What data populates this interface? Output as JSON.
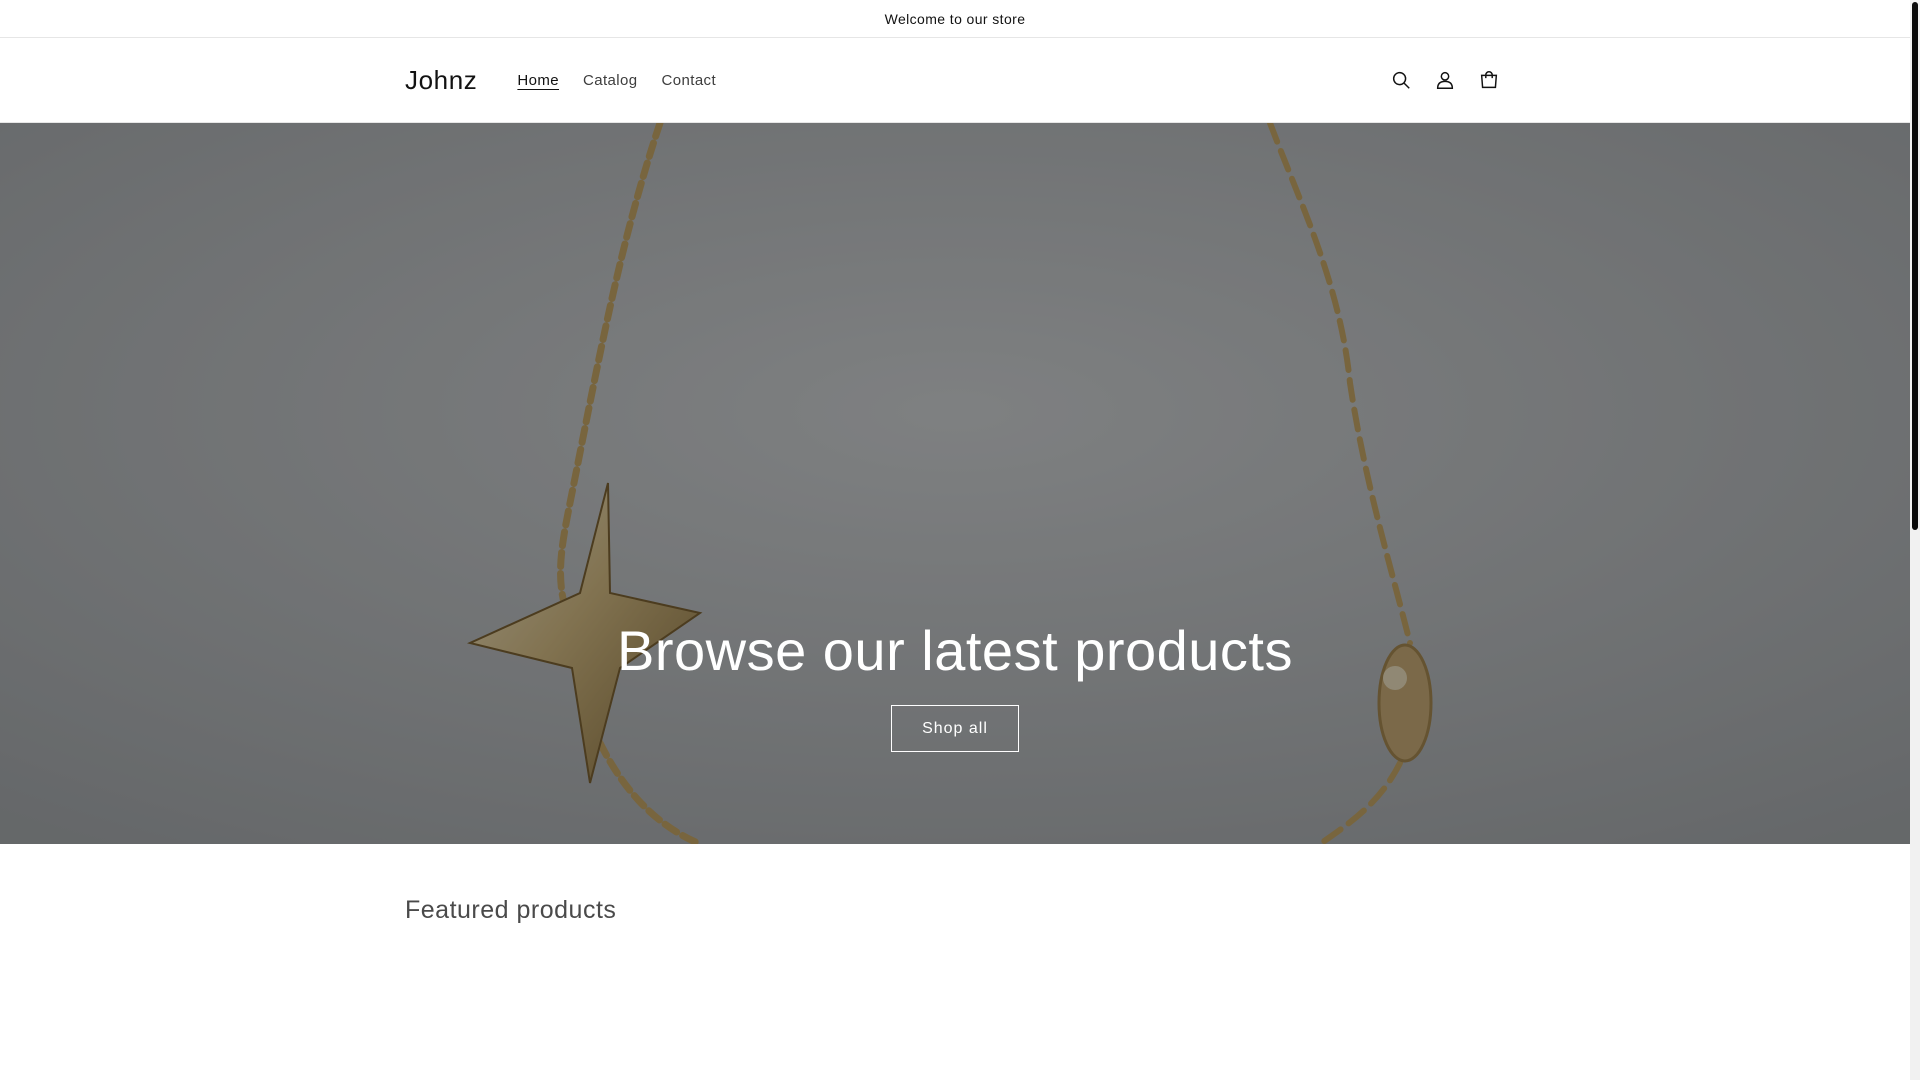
{
  "announcement": {
    "text": "Welcome to our store"
  },
  "header": {
    "logo": "Johnz",
    "nav": [
      {
        "label": "Home",
        "active": true
      },
      {
        "label": "Catalog",
        "active": false
      },
      {
        "label": "Contact",
        "active": false
      }
    ],
    "icons": [
      "search-icon",
      "account-icon",
      "cart-icon"
    ]
  },
  "hero": {
    "title": "Browse our latest products",
    "button_label": "Shop all",
    "image_subject": "gold-star-chain-bracelet"
  },
  "featured": {
    "title": "Featured products"
  },
  "colors": {
    "text": "#121212",
    "overlay": "#000000",
    "hero_text": "#ffffff",
    "gold": "#c9a968"
  }
}
